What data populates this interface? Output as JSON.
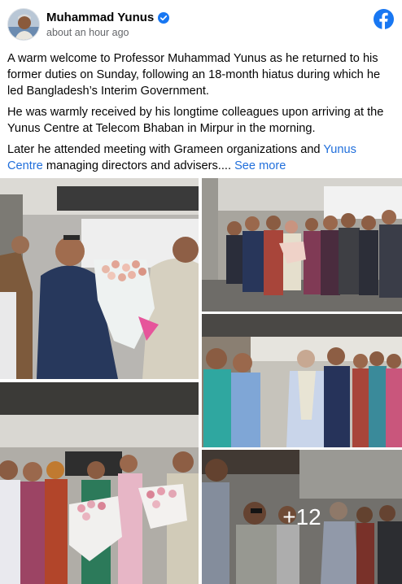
{
  "post": {
    "author": "Muhammad Yunus",
    "timestamp": "about an hour ago",
    "paragraphs": [
      "A warm welcome to Professor Muhammad Yunus as he returned to his former duties on Sunday, following an 18-month hiatus during which he led Bangladesh’s Interim Government.",
      "He was warmly received by his longtime colleagues upon arriving at the Yunus Centre at Telecom Bhaban in Mirpur in the morning."
    ],
    "last_paragraph_prefix": "Later he attended meeting with Grameen organizations and ",
    "last_paragraph_link": "Yunus Centre",
    "last_paragraph_suffix": " managing directors and advisers.... ",
    "see_more": "See more"
  },
  "gallery": {
    "more_count": "+12"
  },
  "icons": {
    "verified": "verified-badge-icon",
    "platform": "facebook-logo-icon"
  },
  "colors": {
    "link": "#216fdb",
    "verified": "#1877f2",
    "facebook": "#1877f2",
    "muted_text": "#65676b"
  }
}
